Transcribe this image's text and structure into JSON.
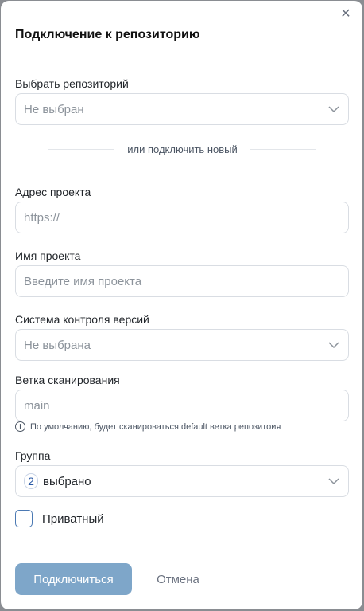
{
  "dialog": {
    "title": "Подключение к репозиторию",
    "close_icon": "close-icon"
  },
  "repo_select": {
    "label": "Выбрать репозиторий",
    "value": "Не выбран"
  },
  "divider_text": "или подключить новый",
  "project_url": {
    "label": "Адрес проекта",
    "placeholder": "https://"
  },
  "project_name": {
    "label": "Имя проекта",
    "placeholder": "Введите имя проекта"
  },
  "vcs": {
    "label": "Система контроля версий",
    "value": "Не выбрана"
  },
  "branch": {
    "label": "Ветка сканирования",
    "placeholder": "main",
    "hint": "По умолчанию, будет сканироваться default ветка репозитоия"
  },
  "group": {
    "label": "Группа",
    "count": "2",
    "value": "выбрано"
  },
  "private": {
    "label": "Приватный",
    "checked": false
  },
  "buttons": {
    "connect": "Подключиться",
    "cancel": "Отмена"
  },
  "colors": {
    "primary": "#7ea6c9",
    "accent": "#4b79b3"
  }
}
